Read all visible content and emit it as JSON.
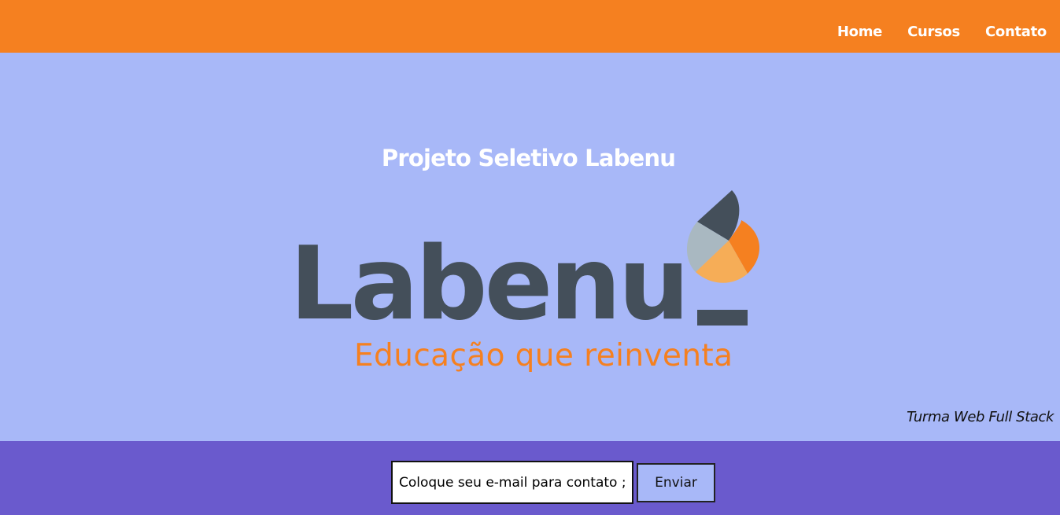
{
  "header": {
    "nav": [
      {
        "label": "Home"
      },
      {
        "label": "Cursos"
      },
      {
        "label": "Contato"
      }
    ]
  },
  "hero": {
    "title": "Projeto Seletivo Labenu",
    "logo": {
      "wordmark": "Labenu",
      "tagline": "Educação que reinventa"
    },
    "subtitle": "Turma Web Full Stack"
  },
  "contact": {
    "placeholder": "Coloque seu e-mail para contato ;)",
    "button_label": "Enviar"
  },
  "colors": {
    "header_bg": "#f58020",
    "hero_bg": "#a8b8f8",
    "footer_bg": "#6a5acd",
    "brand_dark": "#444f5a",
    "brand_orange": "#f58020",
    "brand_light_orange": "#f6ad57",
    "brand_gray": "#a9b8c1"
  }
}
